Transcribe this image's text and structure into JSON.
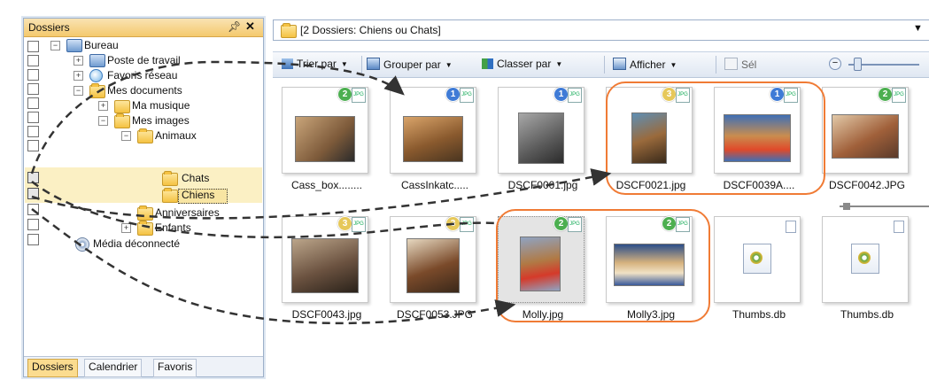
{
  "left_panel": {
    "title": "Dossiers",
    "pin_icon": "pin-icon",
    "close_icon": "close-icon",
    "tree": [
      {
        "label": "Bureau",
        "icon": "desktop-icon"
      },
      {
        "label": "Poste de travail",
        "icon": "computer-icon"
      },
      {
        "label": "Favoris réseau",
        "icon": "network-icon"
      },
      {
        "label": "Mes documents",
        "icon": "folder-icon"
      },
      {
        "label": "Ma musique",
        "icon": "music-folder-icon"
      },
      {
        "label": "Mes images",
        "icon": "folder-icon"
      },
      {
        "label": "Animaux",
        "icon": "folder-icon"
      },
      {
        "label": "Chats",
        "icon": "folder-icon"
      },
      {
        "label": "Chiens",
        "icon": "folder-icon"
      },
      {
        "label": "Anniversaires",
        "icon": "folder-icon"
      },
      {
        "label": "Enfants",
        "icon": "folder-icon"
      },
      {
        "label": "Média déconnecté",
        "icon": "disc-icon"
      }
    ],
    "tabs": [
      "Dossiers",
      "Calendrier",
      "Favoris"
    ],
    "active_tab": "Dossiers"
  },
  "address": {
    "text": "[2 Dossiers: Chiens ou Chats]",
    "dropdown_icon": "chevron-down-icon"
  },
  "toolbar": {
    "sort": "Trier par",
    "group": "Grouper par",
    "stack": "Classer par",
    "view": "Afficher",
    "select": "Sél"
  },
  "files": [
    {
      "name": "Cass_box........",
      "badge": "2",
      "badge_color": "#4caf50"
    },
    {
      "name": "CassInkatc.....",
      "badge": "1",
      "badge_color": "#3f7bd6"
    },
    {
      "name": "DSCF0001.jpg",
      "badge": "1",
      "badge_color": "#3f7bd6"
    },
    {
      "name": "DSCF0021.jpg",
      "badge": "3",
      "badge_color": "#e6c85a"
    },
    {
      "name": "DSCF0039A....",
      "badge": "1",
      "badge_color": "#3f7bd6"
    },
    {
      "name": "DSCF0042.JPG",
      "badge": "2",
      "badge_color": "#4caf50"
    },
    {
      "name": "DSCF0043.jpg",
      "badge": "3",
      "badge_color": "#e6c85a"
    },
    {
      "name": "DSCF0053.JPG",
      "badge": "3",
      "badge_color": "#e6c85a"
    },
    {
      "name": "Molly.jpg",
      "badge": "2",
      "badge_color": "#4caf50"
    },
    {
      "name": "Molly3.jpg",
      "badge": "2",
      "badge_color": "#4caf50"
    },
    {
      "name": "Thumbs.db",
      "badge": "",
      "badge_color": ""
    },
    {
      "name": "Thumbs.db",
      "badge": "",
      "badge_color": ""
    }
  ],
  "colors": {
    "highlight_orange": "#f07b35",
    "selection_yellow": "#fbf0c4",
    "arrow": "#333333"
  }
}
